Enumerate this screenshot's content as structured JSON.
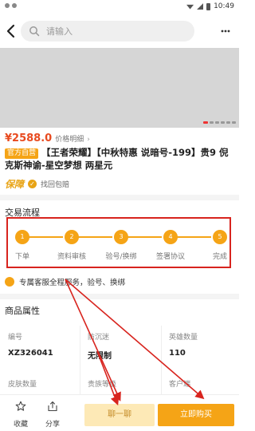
{
  "status_bar": {
    "time": "10:49"
  },
  "search": {
    "placeholder": "请输入"
  },
  "product": {
    "price": "¥2588.0",
    "price_detail": "价格明细",
    "price_detail_arrow": "›",
    "badge": "官方自营",
    "title": "【王者荣耀】【中秋特惠 说暗号-199】贵9 倪克斯神谕-星空梦想 两星元",
    "guarantee_label": "保障",
    "guarantee_text": "找回包赔"
  },
  "flow": {
    "title": "交易流程",
    "steps": [
      {
        "num": "1",
        "label": "下单"
      },
      {
        "num": "2",
        "label": "资料审核"
      },
      {
        "num": "3",
        "label": "验号/换绑"
      },
      {
        "num": "4",
        "label": "签署协议"
      },
      {
        "num": "5",
        "label": "完成"
      }
    ]
  },
  "service": {
    "text": "专属客服全程服务，验号、换绑"
  },
  "attributes": {
    "title": "商品属性",
    "items": [
      {
        "key": "编号",
        "value": "XZ326041"
      },
      {
        "key": "防沉迷",
        "value": "无限制"
      },
      {
        "key": "英雄数量",
        "value": "110"
      },
      {
        "key": "皮肤数量",
        "value": ""
      },
      {
        "key": "贵族等级",
        "value": ""
      },
      {
        "key": "客户端",
        "value": ""
      }
    ]
  },
  "bottom_bar": {
    "favorite_label": "收藏",
    "share_label": "分享",
    "chat_label": "聊一聊",
    "buy_label": "立即购买"
  },
  "colors": {
    "accent": "#f5a416",
    "price": "#e84a1f",
    "annotation_red": "#d8241e"
  }
}
